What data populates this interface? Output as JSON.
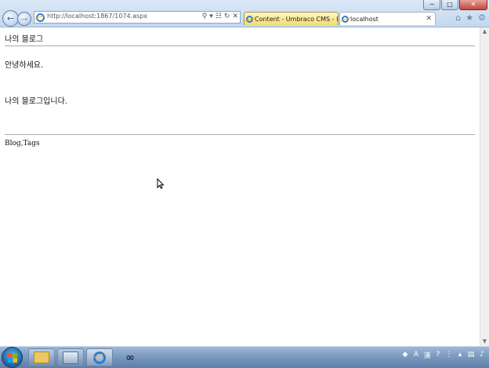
{
  "browser": {
    "url": "http://localhost:1867/1074.aspx",
    "tabs": [
      {
        "label": "Content - Umbraco CMS - lo..."
      },
      {
        "label": "localhost"
      }
    ],
    "window_buttons": {
      "minimize": "─",
      "maximize": "□",
      "close": "✕"
    }
  },
  "page": {
    "blog_title": "나의 블로그",
    "greeting": "안녕하세요.",
    "intro": "나의 블로그입니다.",
    "footer_links": "Blog,Tags"
  },
  "colors": {
    "active_tab": "#f1dd72",
    "taskbar": "#7f9dc2",
    "ie_blue": "#2e7ad6"
  },
  "icons": {
    "back": "back-arrow-icon",
    "forward": "forward-arrow-icon",
    "search": "search-icon",
    "refresh": "refresh-icon",
    "stop": "stop-icon",
    "home": "home-icon",
    "favorites": "star-icon",
    "tools": "gear-icon"
  }
}
